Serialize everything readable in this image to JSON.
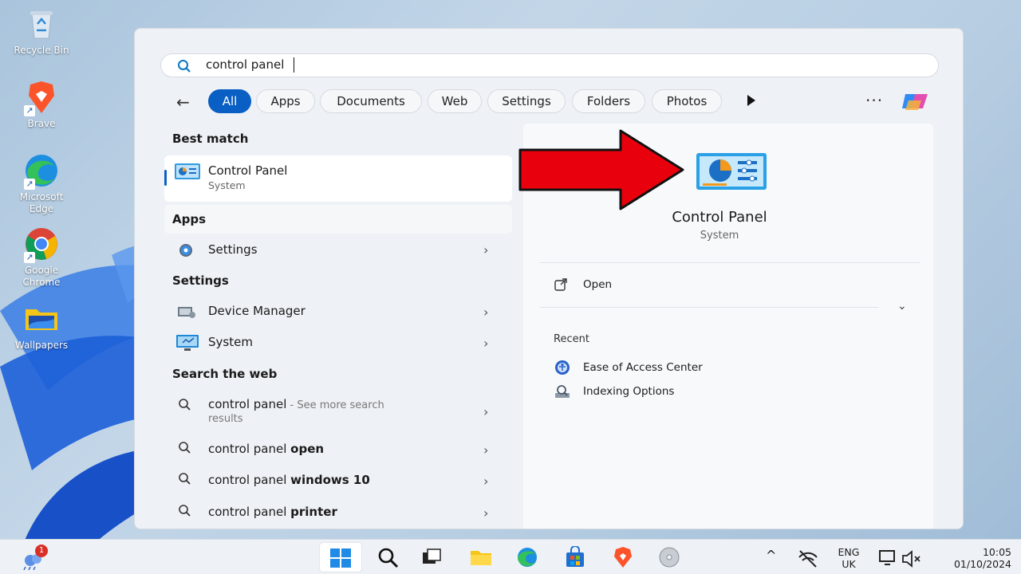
{
  "desktop": {
    "icons": [
      {
        "label": "Recycle Bin",
        "icon": "recycle-bin-icon"
      },
      {
        "label": "Brave",
        "icon": "brave-icon"
      },
      {
        "label": "Microsoft Edge",
        "icon": "edge-icon"
      },
      {
        "label": "Google Chrome",
        "icon": "chrome-icon"
      },
      {
        "label": "Wallpapers",
        "icon": "folder-icon"
      }
    ]
  },
  "search": {
    "query": "control panel",
    "filters": [
      "All",
      "Apps",
      "Documents",
      "Web",
      "Settings",
      "Folders",
      "Photos"
    ],
    "active_filter": "All"
  },
  "results": {
    "best_match_header": "Best match",
    "best_match": {
      "title": "Control Panel",
      "subtitle": "System"
    },
    "apps_header": "Apps",
    "apps": [
      {
        "title": "Settings"
      }
    ],
    "settings_header": "Settings",
    "settings": [
      {
        "title": "Device Manager"
      },
      {
        "title": "System"
      }
    ],
    "web_header": "Search the web",
    "web": [
      {
        "prefix": "control panel",
        "suffix": " - See more search",
        "suffix2": "results"
      },
      {
        "prefix": "control panel ",
        "bold": "open"
      },
      {
        "prefix": "control panel ",
        "bold": "windows 10"
      },
      {
        "prefix": "control panel ",
        "bold": "printer"
      }
    ]
  },
  "preview": {
    "title": "Control Panel",
    "subtitle": "System",
    "open_label": "Open",
    "recent_header": "Recent",
    "recent": [
      "Ease of Access Center",
      "Indexing Options"
    ]
  },
  "taskbar": {
    "notification_count": "1",
    "language_line1": "ENG",
    "language_line2": "UK",
    "time": "10:05",
    "date": "01/10/2024"
  },
  "colors": {
    "accent": "#0a5fc4",
    "arrow": "#e8000d"
  }
}
